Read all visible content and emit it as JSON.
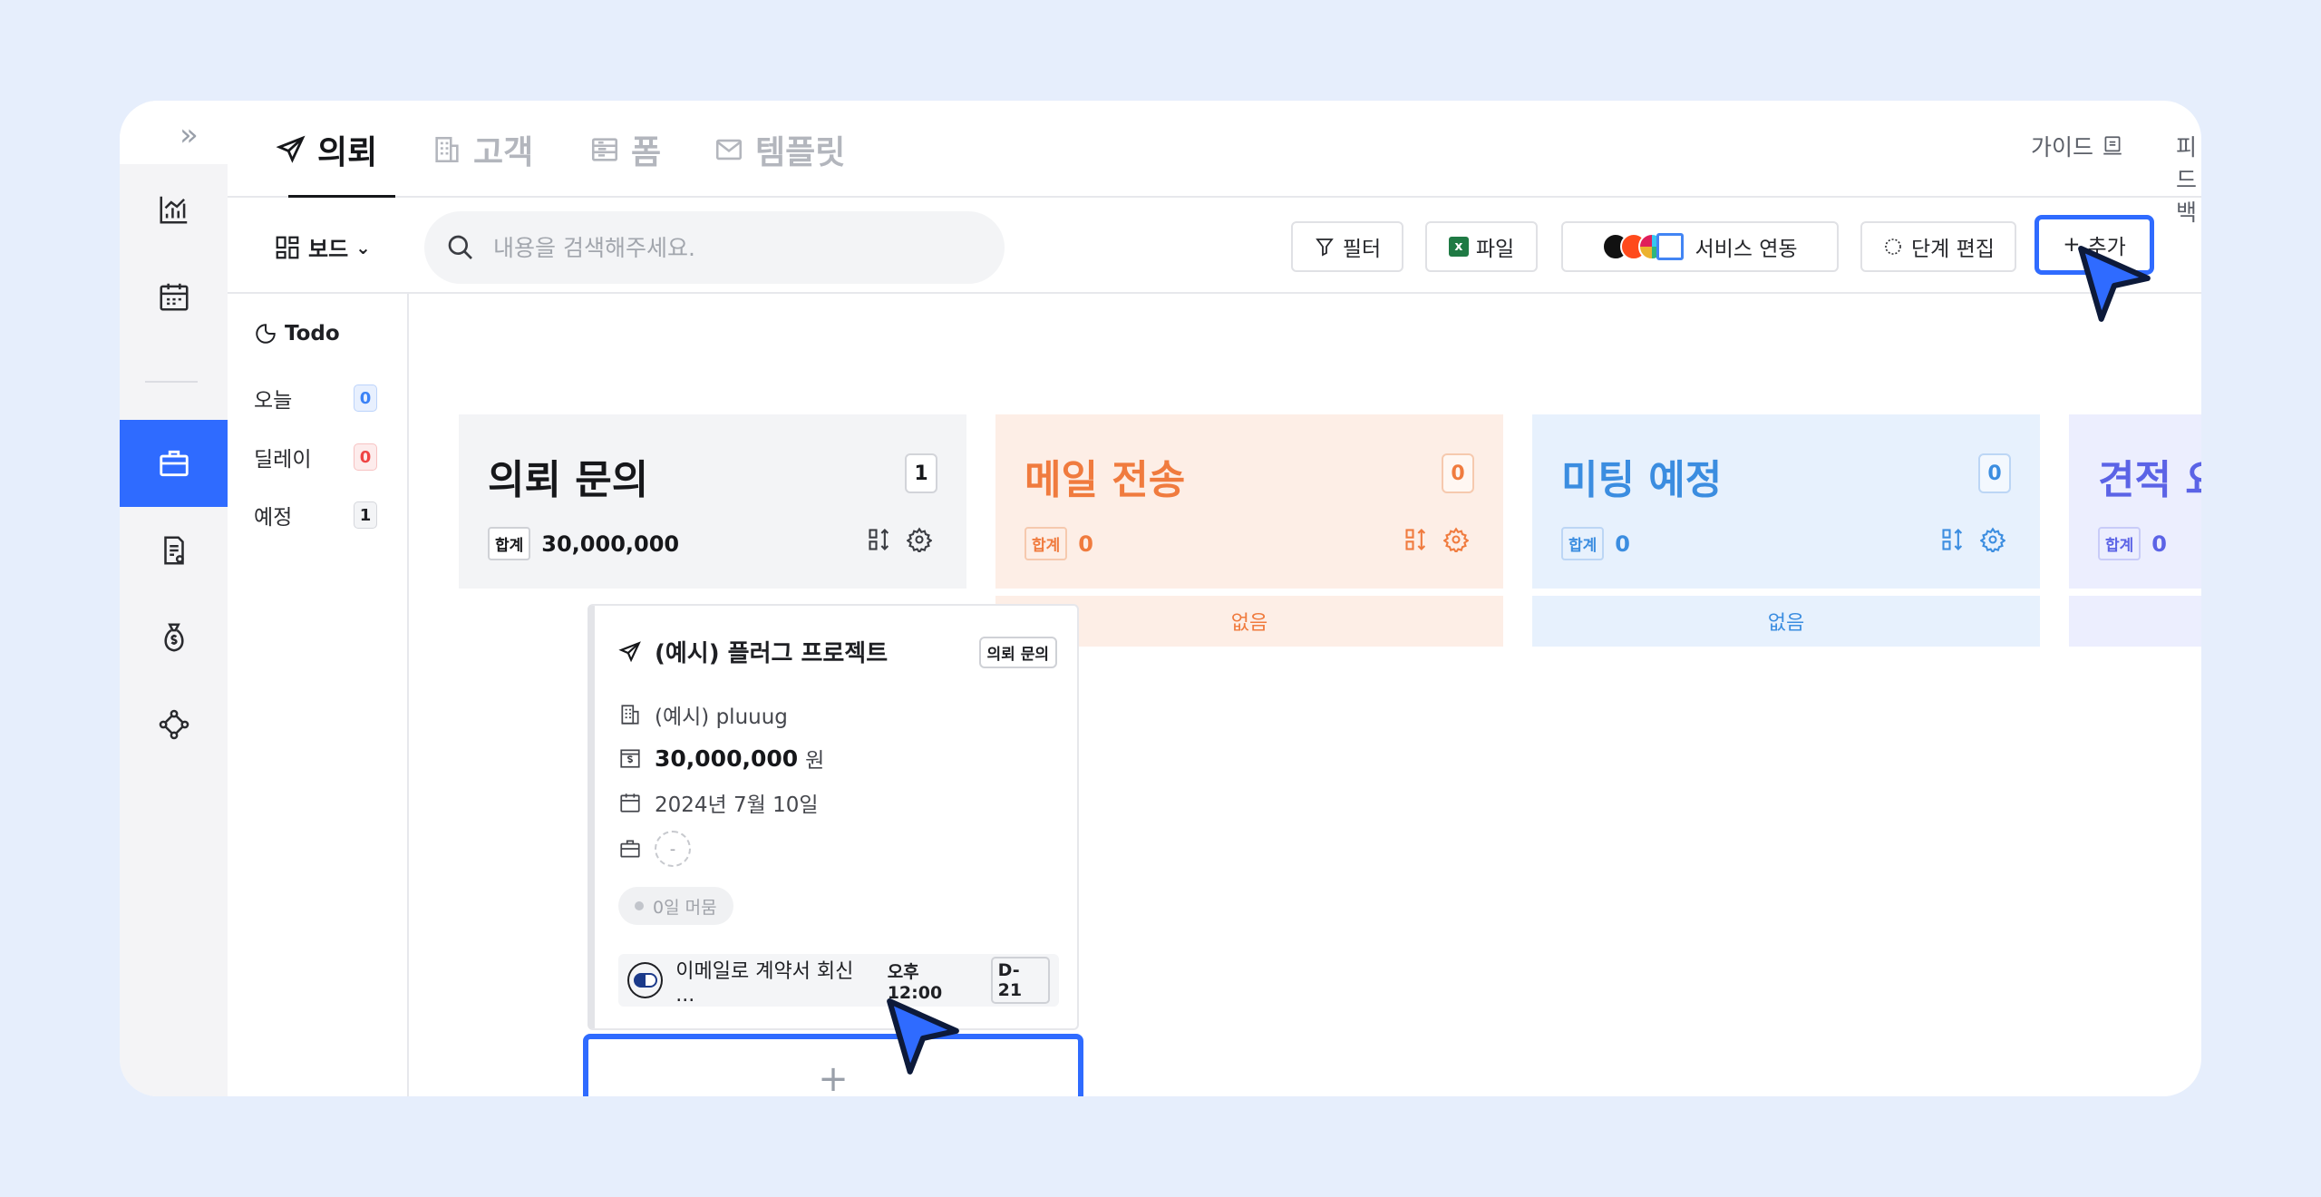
{
  "nav": {
    "expand_icon": "double-chevron-right-icon",
    "items": [
      {
        "icon": "chart-icon"
      },
      {
        "icon": "calendar-icon"
      },
      {
        "icon": "briefcase-icon",
        "active": true
      },
      {
        "icon": "document-icon"
      },
      {
        "icon": "money-bag-icon"
      },
      {
        "icon": "network-icon"
      }
    ]
  },
  "tabs": [
    {
      "label": "의뢰",
      "icon": "paper-plane-icon",
      "active": true
    },
    {
      "label": "고객",
      "icon": "building-icon"
    },
    {
      "label": "폼",
      "icon": "form-icon"
    },
    {
      "label": "템플릿",
      "icon": "mail-icon"
    }
  ],
  "top_links": {
    "guide": "가이드",
    "feedback": "피드백"
  },
  "toolbar": {
    "view_label": "보드",
    "search_placeholder": "내용을 검색해주세요.",
    "filter_label": "필터",
    "file_label": "파일",
    "service_label": "서비스 연동",
    "stage_edit_label": "단계 편집",
    "add_label": "추가"
  },
  "todo": {
    "title": "Todo",
    "rows": [
      {
        "label": "오늘",
        "count": "0",
        "color": "#3b82f6"
      },
      {
        "label": "딜레이",
        "count": "0",
        "color": "#ef4444"
      },
      {
        "label": "예정",
        "count": "1",
        "color": "#1f2024"
      }
    ]
  },
  "columns": [
    {
      "title": "의뢰 문의",
      "count": "1",
      "sum_tag": "합계",
      "sum": "30,000,000",
      "bg": "#f3f4f6",
      "fg": "#16171a",
      "empty": ""
    },
    {
      "title": "메일 전송",
      "count": "0",
      "sum_tag": "합계",
      "sum": "0",
      "bg": "#fdeee6",
      "fg": "#f07b3e",
      "empty": "없음"
    },
    {
      "title": "미팅 예정",
      "count": "0",
      "sum_tag": "합계",
      "sum": "0",
      "bg": "#e7f1fd",
      "fg": "#3b8de0",
      "empty": "없음"
    },
    {
      "title": "견적 요",
      "count": "",
      "sum_tag": "합계",
      "sum": "0",
      "bg": "#eceefe",
      "fg": "#5b63e6",
      "empty": ""
    }
  ],
  "card": {
    "title": "(예시) 플러그 프로젝트",
    "badge": "의뢰 문의",
    "client": "(예시) pluuug",
    "amount": "30,000,000",
    "currency": "원",
    "date": "2024년 7월 10일",
    "assignee": "-",
    "stay": "0일 머뭄",
    "task": {
      "text": "이메일로 계약서 회신 ...",
      "time": "오후 12:00",
      "dday": "D-21"
    }
  },
  "add_card_label": "+"
}
